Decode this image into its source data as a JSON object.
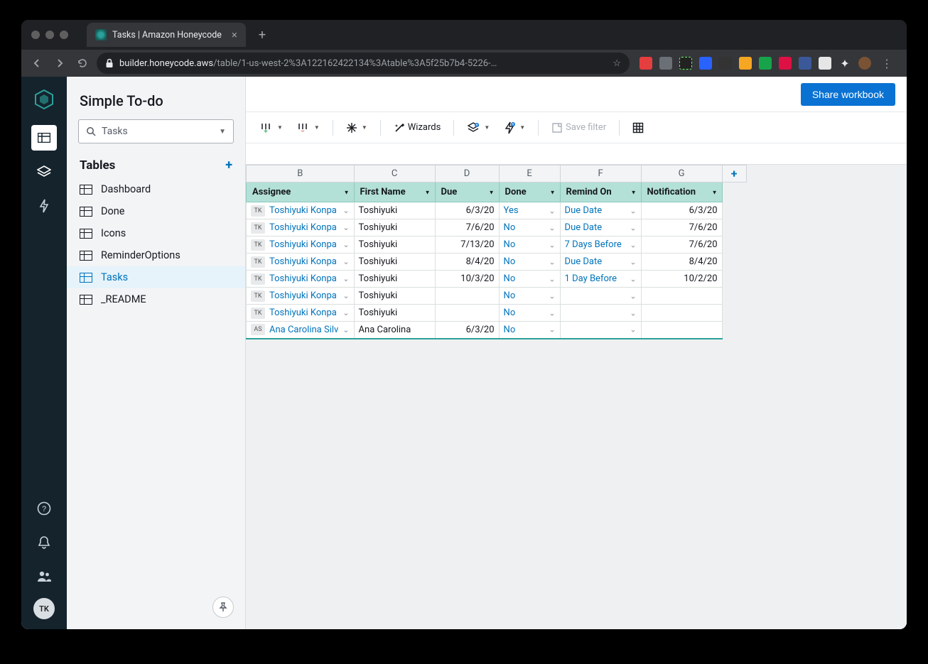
{
  "browser": {
    "tab_title": "Tasks | Amazon Honeycode",
    "url_host": "builder.honeycode.aws",
    "url_path": "/table/1-us-west-2%3A122162422134%3Atable%3A5f25b7b4-5226-…"
  },
  "sidebar": {
    "workbook_title": "Simple To-do",
    "selector_value": "Tasks",
    "tables_header": "Tables",
    "items": [
      {
        "label": "Dashboard"
      },
      {
        "label": "Done"
      },
      {
        "label": "Icons"
      },
      {
        "label": "ReminderOptions"
      },
      {
        "label": "Tasks"
      },
      {
        "label": "_README"
      }
    ]
  },
  "topbar": {
    "share_label": "Share workbook"
  },
  "toolbar": {
    "wizards": "Wizards",
    "save_filter": "Save filter"
  },
  "grid": {
    "column_letters": [
      "B",
      "C",
      "D",
      "E",
      "F",
      "G"
    ],
    "headers": [
      "Assignee",
      "First Name",
      "Due",
      "Done",
      "Remind On",
      "Notification"
    ],
    "rows": [
      {
        "initials": "TK",
        "assignee": "Toshiyuki Konpa",
        "first": "Toshiyuki",
        "due": "6/3/20",
        "done": "Yes",
        "remind": "Due Date",
        "notif": "6/3/20"
      },
      {
        "initials": "TK",
        "assignee": "Toshiyuki Konpa",
        "first": "Toshiyuki",
        "due": "7/6/20",
        "done": "No",
        "remind": "Due Date",
        "notif": "7/6/20"
      },
      {
        "initials": "TK",
        "assignee": "Toshiyuki Konpa",
        "first": "Toshiyuki",
        "due": "7/13/20",
        "done": "No",
        "remind": "7 Days Before",
        "notif": "7/6/20"
      },
      {
        "initials": "TK",
        "assignee": "Toshiyuki Konpa",
        "first": "Toshiyuki",
        "due": "8/4/20",
        "done": "No",
        "remind": "Due Date",
        "notif": "8/4/20"
      },
      {
        "initials": "TK",
        "assignee": "Toshiyuki Konpa",
        "first": "Toshiyuki",
        "due": "10/3/20",
        "done": "No",
        "remind": "1 Day Before",
        "notif": "10/2/20"
      },
      {
        "initials": "TK",
        "assignee": "Toshiyuki Konpa",
        "first": "Toshiyuki",
        "due": "",
        "done": "No",
        "remind": "",
        "notif": ""
      },
      {
        "initials": "TK",
        "assignee": "Toshiyuki Konpa",
        "first": "Toshiyuki",
        "due": "",
        "done": "No",
        "remind": "",
        "notif": ""
      },
      {
        "initials": "AS",
        "assignee": "Ana Carolina Silv",
        "first": "Ana Carolina",
        "due": "6/3/20",
        "done": "No",
        "remind": "",
        "notif": ""
      }
    ]
  },
  "rail": {
    "avatar_initials": "TK"
  }
}
